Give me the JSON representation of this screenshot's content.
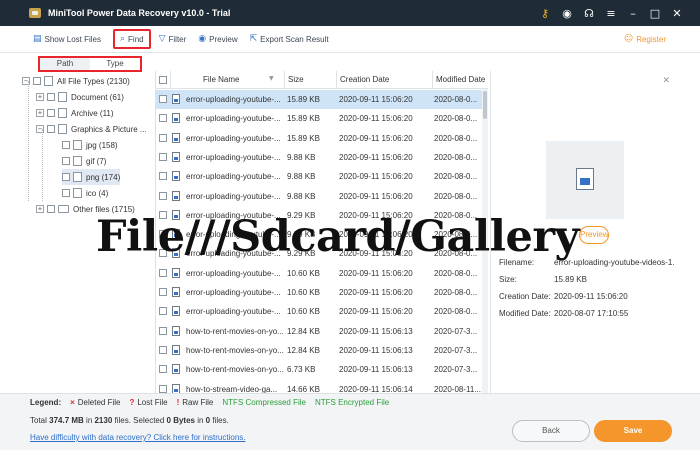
{
  "window": {
    "title": "MiniTool Power Data Recovery v10.0 - Trial",
    "icons": [
      "key-icon",
      "disc-icon",
      "headset-icon",
      "menu-icon",
      "minimize-icon",
      "maximize-icon",
      "close-icon"
    ],
    "icon_glyphs": [
      "⚷",
      "◉",
      "☊",
      "≡",
      "–",
      "□",
      "✕"
    ]
  },
  "toolbar": {
    "show_lost_files": "Show Lost Files",
    "find": "Find",
    "filter": "Filter",
    "preview": "Preview",
    "export": "Export Scan Result",
    "register": "Register"
  },
  "tabs": {
    "path": "Path",
    "type": "Type"
  },
  "tree": [
    {
      "label": "All File Types (2130)",
      "level": 0,
      "expander": "−"
    },
    {
      "label": "Document (61)",
      "level": 1,
      "expander": "+"
    },
    {
      "label": "Archive (11)",
      "level": 1,
      "expander": "+"
    },
    {
      "label": "Graphics & Picture ...",
      "level": 1,
      "expander": "−"
    },
    {
      "label": "jpg (158)",
      "level": 2,
      "expander": ""
    },
    {
      "label": "gif (7)",
      "level": 2,
      "expander": ""
    },
    {
      "label": "png (174)",
      "level": 2,
      "expander": ""
    },
    {
      "label": "ico (4)",
      "level": 2,
      "expander": ""
    },
    {
      "label": "Other files (1715)",
      "level": 1,
      "expander": "+"
    }
  ],
  "table": {
    "columns": [
      "File Name",
      "Size",
      "Creation Date",
      "Modified Date"
    ],
    "rows": [
      [
        "error-uploading-youtube-...",
        "15.89 KB",
        "2020-09-11 15:06:20",
        "2020-08-0..."
      ],
      [
        "error-uploading-youtube-...",
        "15.89 KB",
        "2020-09-11 15:06:20",
        "2020-08-0..."
      ],
      [
        "error-uploading-youtube-...",
        "15.89 KB",
        "2020-09-11 15:06:20",
        "2020-08-0..."
      ],
      [
        "error-uploading-youtube-...",
        "9.88 KB",
        "2020-09-11 15:06:20",
        "2020-08-0..."
      ],
      [
        "error-uploading-youtube-...",
        "9.88 KB",
        "2020-09-11 15:06:20",
        "2020-08-0..."
      ],
      [
        "error-uploading-youtube-...",
        "9.88 KB",
        "2020-09-11 15:06:20",
        "2020-08-0..."
      ],
      [
        "error-uploading-youtube-...",
        "9.29 KB",
        "2020-09-11 15:06:20",
        "2020-08-0..."
      ],
      [
        "error-uploading-youtube-...",
        "9.29 KB",
        "2020-09-11 15:06:20",
        "2020-08-0..."
      ],
      [
        "error-uploading-youtube-...",
        "9.29 KB",
        "2020-09-11 15:06:20",
        "2020-08-0..."
      ],
      [
        "error-uploading-youtube-...",
        "10.60 KB",
        "2020-09-11 15:06:20",
        "2020-08-0..."
      ],
      [
        "error-uploading-youtube-...",
        "10.60 KB",
        "2020-09-11 15:06:20",
        "2020-08-0..."
      ],
      [
        "error-uploading-youtube-...",
        "10.60 KB",
        "2020-09-11 15:06:20",
        "2020-08-0..."
      ],
      [
        "how-to-rent-movies-on-yo...",
        "12.84 KB",
        "2020-09-11 15:06:13",
        "2020-07-3..."
      ],
      [
        "how-to-rent-movies-on-yo...",
        "12.84 KB",
        "2020-09-11 15:06:13",
        "2020-07-3..."
      ],
      [
        "how-to-rent-movies-on-yo...",
        "6.73 KB",
        "2020-09-11 15:06:13",
        "2020-07-3..."
      ],
      [
        "how-to-stream-video-ga...",
        "14.66 KB",
        "2020-09-11 15:06:14",
        "2020-08-11..."
      ]
    ]
  },
  "preview": {
    "button": "Preview",
    "filename_label": "Filename:",
    "filename_value": "error-uploading-youtube-videos-1.",
    "size_label": "Size:",
    "size_value": "15.89 KB",
    "creation_label": "Creation Date:",
    "creation_value": "2020-09-11 15:06:20",
    "modified_label": "Modified Date:",
    "modified_value": "2020-08-07 17:10:55"
  },
  "watermark": "File///Sdcard/Gallery",
  "legend": {
    "title": "Legend:",
    "deleted": "Deleted File",
    "lost": "Lost File",
    "raw": "Raw File",
    "ntfs_compressed": "NTFS Compressed File",
    "ntfs_encrypted": "NTFS Encrypted File"
  },
  "status": {
    "total_prefix": "Total ",
    "total_size": "374.7 MB",
    "in_text": " in ",
    "total_files": "2130",
    "files_selected_text": " files.  Selected ",
    "selected_size": "0 Bytes",
    "in_text2": " in ",
    "selected_files": "0",
    "files_end": " files.",
    "help_link": "Have difficulty with data recovery? Click here for instructions."
  },
  "buttons": {
    "back": "Back",
    "save": "Save"
  },
  "colors": {
    "titlebar": "#1f2b37",
    "accent": "#f4962b",
    "highlight_border": "#e8252d",
    "selected_row": "#cfe5f7",
    "link": "#2e6fc8"
  }
}
